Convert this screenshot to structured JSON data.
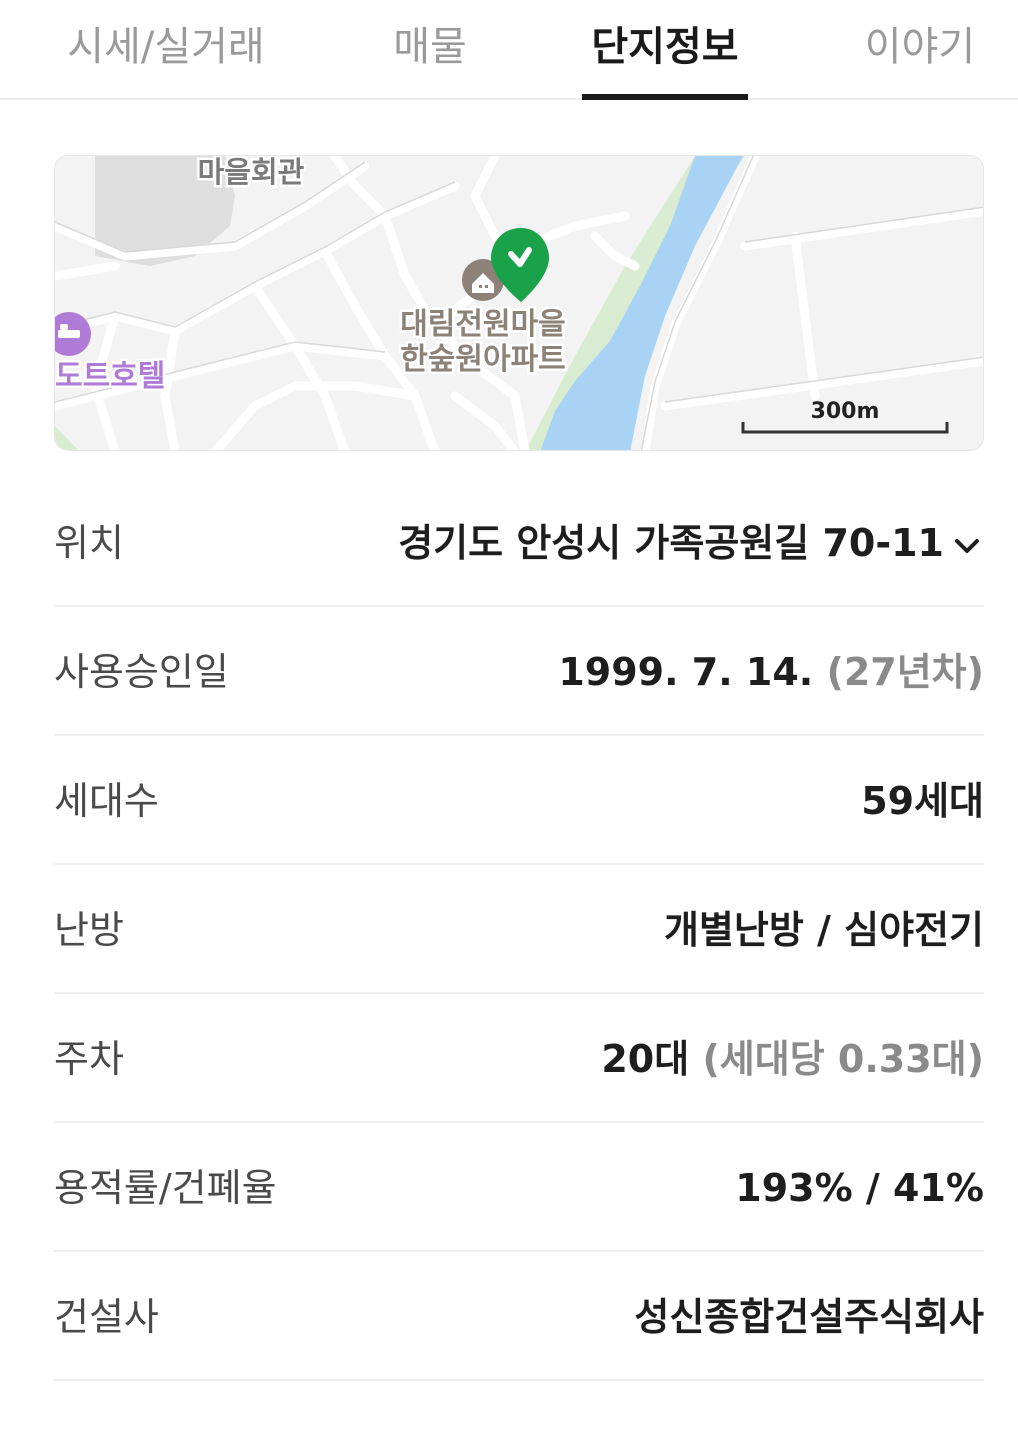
{
  "tabs": [
    {
      "label": "시세/실거래"
    },
    {
      "label": "매물"
    },
    {
      "label": "단지정보"
    },
    {
      "label": "이야기"
    }
  ],
  "active_tab_index": 2,
  "map": {
    "labels": {
      "village_hall": "마을회관",
      "apartment_line1": "대림전원마을",
      "apartment_line2": "한숲원아파트",
      "hotel": "도트호텔",
      "scale": "300m"
    },
    "icons": [
      "building-icon",
      "location-pin-icon",
      "hotel-icon"
    ],
    "colors": {
      "river": "#a8d3f5",
      "pin": "#1aa24b",
      "hotel": "#b07bd6"
    }
  },
  "info": {
    "location": {
      "label": "위치",
      "value": "경기도 안성시 가족공원길 70-11"
    },
    "approval_date": {
      "label": "사용승인일",
      "value": "1999. 7. 14.",
      "sub": "(27년차)"
    },
    "households": {
      "label": "세대수",
      "value": "59세대"
    },
    "heating": {
      "label": "난방",
      "value": "개별난방 / 심야전기"
    },
    "parking": {
      "label": "주차",
      "value": "20대",
      "sub": "(세대당 0.33대)"
    },
    "ratio": {
      "label": "용적률/건폐율",
      "value": "193% / 41%"
    },
    "builder": {
      "label": "건설사",
      "value": "성신종합건설주식회사"
    }
  }
}
